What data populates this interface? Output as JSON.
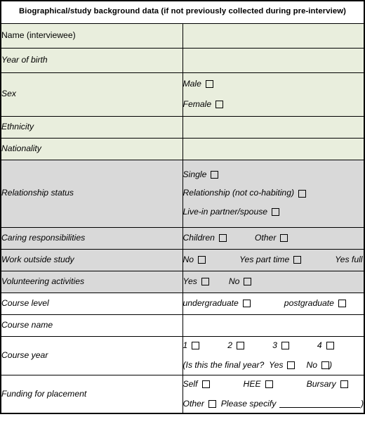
{
  "header": {
    "title": "Biographical/study background data (if not previously collected during pre-interview)"
  },
  "rows": [
    {
      "id": "name",
      "label": "Name (interviewee)",
      "tint": "green",
      "value_type": "blank",
      "lines": []
    },
    {
      "id": "year-of-birth",
      "label": "Year of birth",
      "tint": "green",
      "value_type": "blank",
      "lines": []
    },
    {
      "id": "sex",
      "label": "Sex",
      "tint": "green",
      "value_type": "options",
      "lines": [
        {
          "options": [
            {
              "label": "Male",
              "checked": false
            }
          ]
        },
        {
          "options": [
            {
              "label": "Female",
              "checked": false
            }
          ]
        }
      ]
    },
    {
      "id": "ethnicity",
      "label": "Ethnicity",
      "tint": "green",
      "value_type": "blank",
      "lines": []
    },
    {
      "id": "nationality",
      "label": "Nationality",
      "tint": "green",
      "value_type": "blank",
      "lines": []
    },
    {
      "id": "relationship-status",
      "label": "Relationship status",
      "tint": "gray",
      "value_type": "options",
      "lines": [
        {
          "options": [
            {
              "label": "Single",
              "checked": false
            }
          ]
        },
        {
          "options": [
            {
              "label": "Relationship (not co-habiting)",
              "checked": false
            }
          ]
        },
        {
          "options": [
            {
              "label": "Live-in partner/spouse",
              "checked": false
            }
          ]
        }
      ]
    },
    {
      "id": "caring-responsibilities",
      "label": "Caring responsibilities",
      "tint": "gray",
      "value_type": "options",
      "lines": [
        {
          "options": [
            {
              "label": "Children",
              "checked": false
            },
            {
              "label": "Other",
              "checked": false
            }
          ]
        }
      ]
    },
    {
      "id": "work-outside-study",
      "label": "Work outside study",
      "tint": "gray",
      "value_type": "options",
      "lines": [
        {
          "options": [
            {
              "label": "No",
              "checked": false
            },
            {
              "label": "Yes part time",
              "checked": false
            },
            {
              "label": "Yes full time",
              "checked": false
            }
          ]
        }
      ]
    },
    {
      "id": "volunteering-activities",
      "label": "Volunteering activities",
      "tint": "gray",
      "value_type": "options",
      "lines": [
        {
          "options": [
            {
              "label": "Yes",
              "checked": false
            },
            {
              "label": "No",
              "checked": false
            }
          ]
        }
      ]
    },
    {
      "id": "course-level",
      "label": "Course level",
      "tint": "white",
      "value_type": "options",
      "lines": [
        {
          "options": [
            {
              "label": "undergraduate",
              "checked": false
            },
            {
              "label": "postgraduate",
              "checked": false
            }
          ]
        }
      ]
    },
    {
      "id": "course-name",
      "label": "Course name",
      "tint": "white",
      "value_type": "blank",
      "lines": []
    },
    {
      "id": "course-year",
      "label": "Course year",
      "tint": "white",
      "value_type": "options",
      "lines": [
        {
          "options": [
            {
              "label": "1",
              "checked": false
            },
            {
              "label": "2",
              "checked": false
            },
            {
              "label": "3",
              "checked": false
            },
            {
              "label": "4",
              "checked": false
            }
          ]
        },
        {
          "prefix": "(Is this the final year?",
          "options": [
            {
              "label": "Yes",
              "checked": false
            },
            {
              "label": "No",
              "checked": false
            }
          ],
          "suffix": ")"
        }
      ]
    },
    {
      "id": "funding-for-placement",
      "label": "Funding for placement",
      "tint": "white",
      "value_type": "options",
      "lines": [
        {
          "options": [
            {
              "label": "Self",
              "checked": false
            },
            {
              "label": "HEE",
              "checked": false
            },
            {
              "label": "Bursary",
              "checked": false
            }
          ]
        },
        {
          "options": [
            {
              "label": "Other",
              "checked": false
            }
          ],
          "specify_label": "Please specify",
          "specify_blank": true,
          "suffix": ")"
        }
      ]
    }
  ],
  "colors": {
    "row_tint_green": "#e9eedd",
    "row_tint_gray": "#d9d9d9",
    "row_tint_white": "#ffffff",
    "border": "#000000",
    "text": "#000000"
  }
}
